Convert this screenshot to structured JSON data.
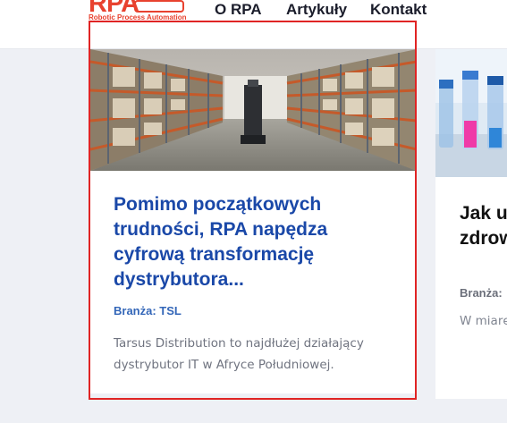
{
  "header": {
    "logo_text": "RPA",
    "logo_tagline": "Robotic Process Automation",
    "nav": [
      {
        "label": "O RPA"
      },
      {
        "label": "Artykuły"
      },
      {
        "label": "Kontakt"
      }
    ]
  },
  "cards": [
    {
      "image": "warehouse-aisle-photo",
      "title": "Pomimo początkowych trudności, RPA napędza cyfrową transformację dystrybutora...",
      "category": "Branża: TSL",
      "description": "Tarsus Distribution to najdłużej działający dystrybutor IT w Afryce Południowej."
    },
    {
      "image": "laboratory-test-tubes-photo",
      "title": "Jak usprawnić zdrowie",
      "category": "Branża: ",
      "description": "W miarę wyzwań"
    }
  ],
  "colors": {
    "brand": "#e8422f",
    "title_blue": "#1a48a8",
    "category_blue": "#3366b8",
    "selection_border": "#e02424",
    "page_bg": "#eef0f5"
  }
}
